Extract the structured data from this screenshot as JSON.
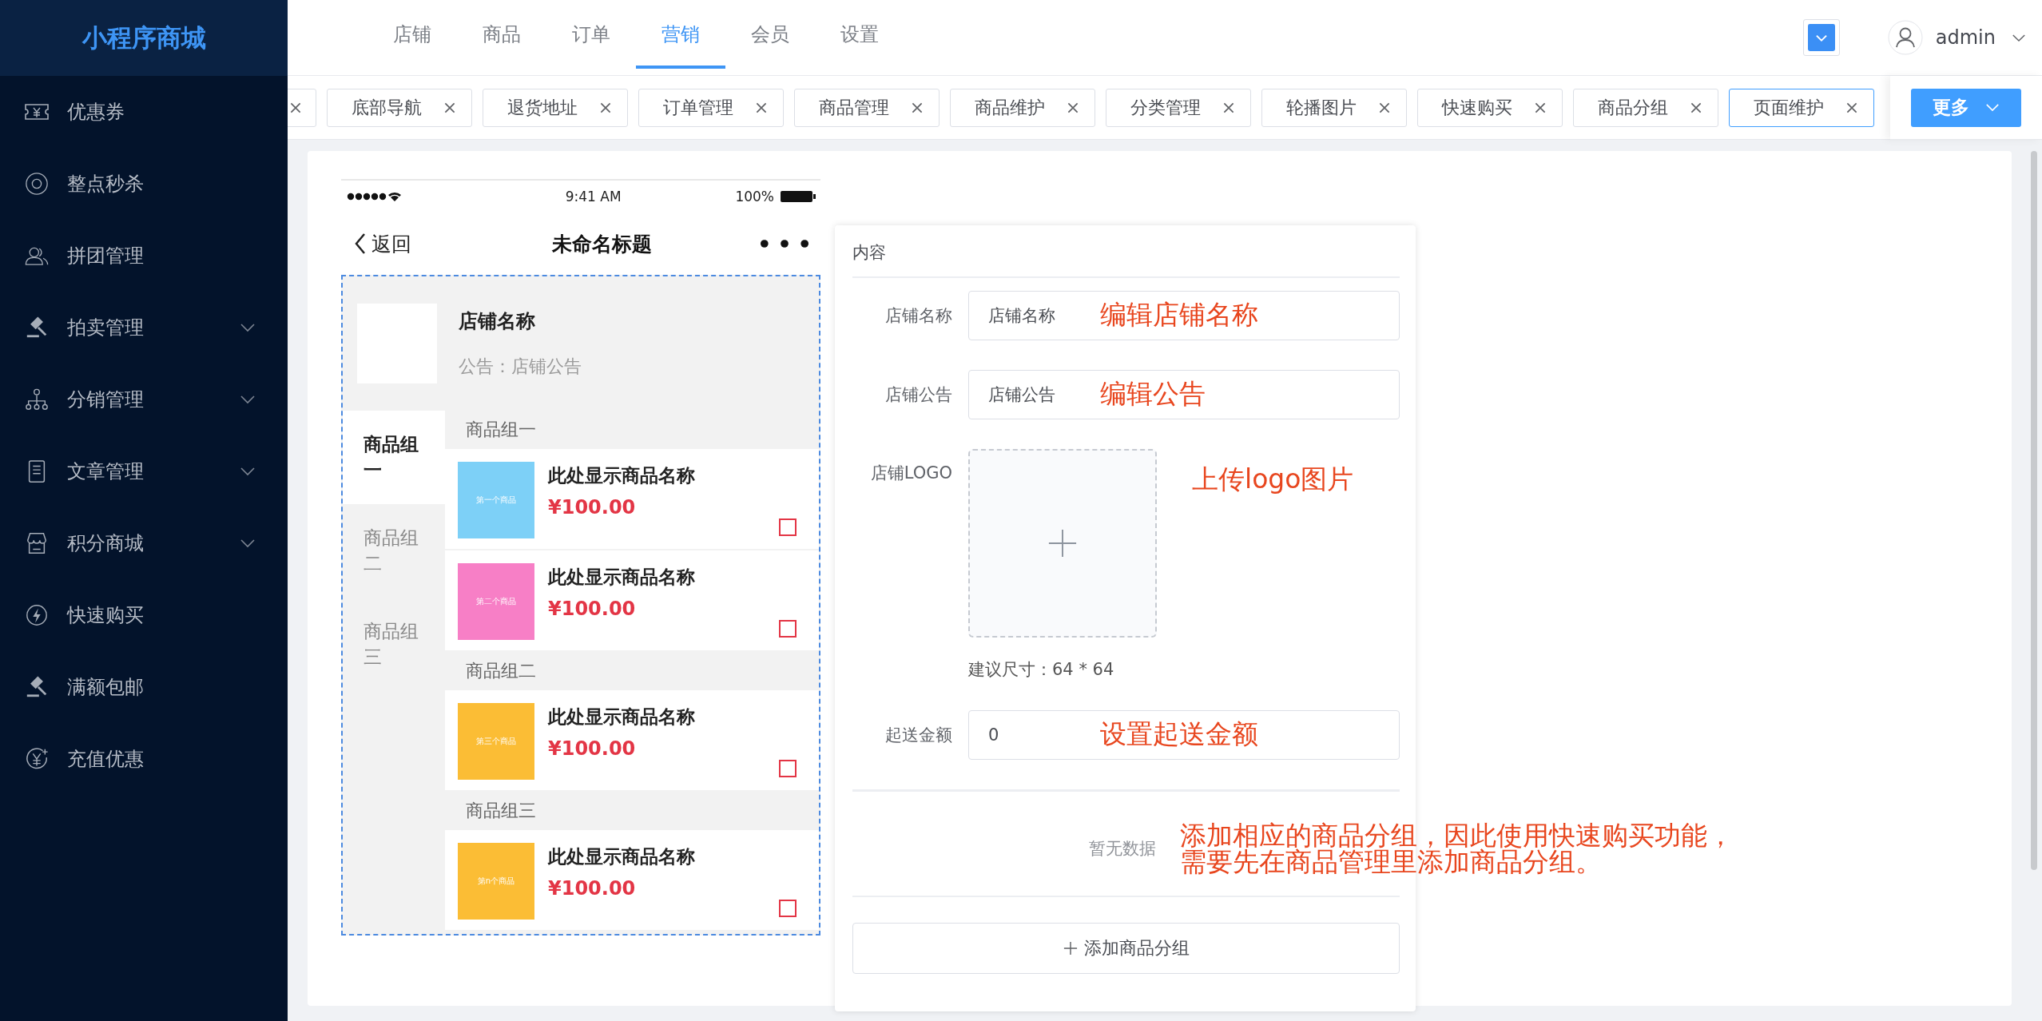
{
  "sidebar": {
    "logo": "小程序商城",
    "items": [
      {
        "label": "优惠券",
        "expandable": false
      },
      {
        "label": "整点秒杀",
        "expandable": false
      },
      {
        "label": "拼团管理",
        "expandable": false
      },
      {
        "label": "拍卖管理",
        "expandable": true
      },
      {
        "label": "分销管理",
        "expandable": true
      },
      {
        "label": "文章管理",
        "expandable": true
      },
      {
        "label": "积分商城",
        "expandable": true
      },
      {
        "label": "快速购买",
        "expandable": false
      },
      {
        "label": "满额包邮",
        "expandable": false
      },
      {
        "label": "充值优惠",
        "expandable": false
      }
    ]
  },
  "top_nav": {
    "items": [
      {
        "label": "店铺",
        "selected": false
      },
      {
        "label": "商品",
        "selected": false
      },
      {
        "label": "订单",
        "selected": false
      },
      {
        "label": "营销",
        "selected": true
      },
      {
        "label": "会员",
        "selected": false
      },
      {
        "label": "设置",
        "selected": false
      }
    ],
    "user": {
      "name": "admin"
    }
  },
  "tabs": {
    "cut_off_before": true,
    "items": [
      {
        "label": "底部导航",
        "selected": false
      },
      {
        "label": "退货地址",
        "selected": false
      },
      {
        "label": "订单管理",
        "selected": false
      },
      {
        "label": "商品管理",
        "selected": false
      },
      {
        "label": "商品维护",
        "selected": false
      },
      {
        "label": "分类管理",
        "selected": false
      },
      {
        "label": "轮播图片",
        "selected": false
      },
      {
        "label": "快速购买",
        "selected": false
      },
      {
        "label": "商品分组",
        "selected": false
      },
      {
        "label": "页面维护",
        "selected": true
      }
    ],
    "more_button": "更多"
  },
  "phone": {
    "status_bar": {
      "time": "9:41 AM",
      "battery": "100%"
    },
    "nav": {
      "back": "返回",
      "title": "未命名标题"
    },
    "store": {
      "name": "店铺名称",
      "notice": "公告：店铺公告"
    },
    "categories": [
      {
        "label": "商品组一",
        "selected": true
      },
      {
        "label": "商品组二",
        "selected": false
      },
      {
        "label": "商品组三",
        "selected": false
      }
    ],
    "groups": [
      {
        "title": "商品组一",
        "products": [
          {
            "name": "此处显示商品名称",
            "price": "¥100.00",
            "color": "#7dd0f7",
            "image_label": "第一个商品",
            "checked": false
          },
          {
            "name": "此处显示商品名称",
            "price": "¥100.00",
            "color": "#f77fc6",
            "image_label": "第二个商品",
            "checked": false
          }
        ]
      },
      {
        "title": "商品组二",
        "products": [
          {
            "name": "此处显示商品名称",
            "price": "¥100.00",
            "color": "#fbbd35",
            "image_label": "第三个商品",
            "checked": false
          }
        ]
      },
      {
        "title": "商品组三",
        "products": [
          {
            "name": "此处显示商品名称",
            "price": "¥100.00",
            "color": "#fbbd35",
            "image_label": "第n个商品",
            "checked": false
          }
        ]
      }
    ]
  },
  "form": {
    "title": "内容",
    "fields": [
      {
        "kind": "text",
        "label": "店铺名称",
        "value": "店铺名称",
        "annotation": "编辑店铺名称"
      },
      {
        "kind": "text",
        "label": "店铺公告",
        "value": "店铺公告",
        "annotation": "编辑公告"
      },
      {
        "kind": "upload",
        "label": "店铺LOGO",
        "hint": "建议尺寸：64 * 64",
        "annotation": "上传logo图片"
      },
      {
        "kind": "text",
        "label": "起送金额",
        "value": "0",
        "annotation": "设置起送金额"
      }
    ],
    "empty_text": "暂无数据",
    "empty_annotation_lines": [
      "添加相应的商品分组，因此使用快速购买功能，",
      "需要先在商品管理里添加商品分组。"
    ],
    "add_button": "添加商品分组"
  }
}
